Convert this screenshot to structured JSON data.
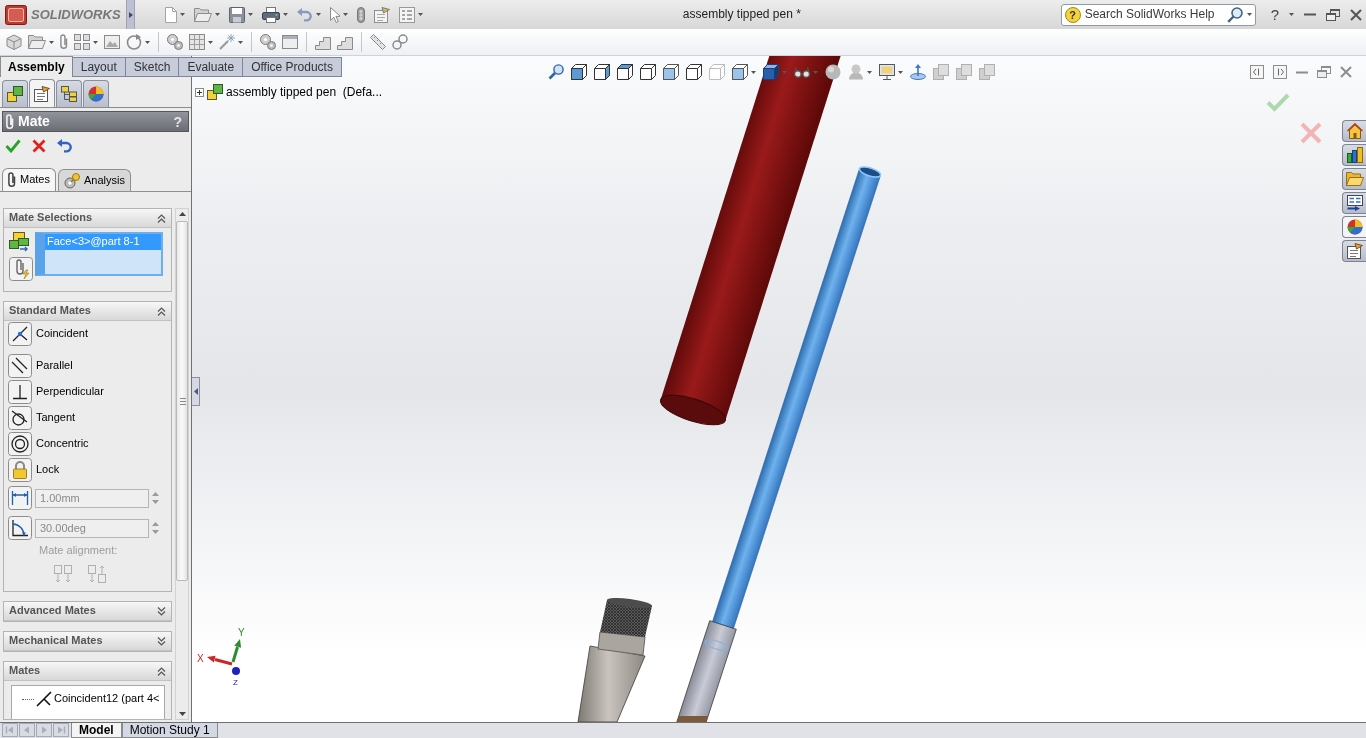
{
  "app": {
    "logo": "SOLIDWORKS",
    "title": "assembly tipped pen *",
    "search": {
      "badge": "?",
      "placeholder": "Search SolidWorks Help"
    },
    "help": "?"
  },
  "command_tabs": [
    {
      "label": "Assembly",
      "selected": true
    },
    {
      "label": "Layout",
      "selected": false
    },
    {
      "label": "Sketch",
      "selected": false
    },
    {
      "label": "Evaluate",
      "selected": false
    },
    {
      "label": "Office Products",
      "selected": false
    }
  ],
  "manager_tabs": [
    {
      "kind": "tree",
      "selected": false
    },
    {
      "kind": "property",
      "selected": true
    },
    {
      "kind": "configuration",
      "selected": false
    },
    {
      "kind": "display",
      "selected": false
    }
  ],
  "property_manager": {
    "title": "Mate",
    "help": "?",
    "tabs": [
      {
        "kind": "mates",
        "label": "Mates",
        "selected": true
      },
      {
        "kind": "analysis",
        "label": "Analysis",
        "selected": false
      }
    ],
    "groups": [
      {
        "kind": "selections",
        "title": "Mate Selections",
        "expanded": true,
        "items": [
          {
            "label": "Face<3>@part 8-1",
            "selected": true
          }
        ]
      },
      {
        "kind": "standard",
        "title": "Standard Mates",
        "expanded": true,
        "options": [
          {
            "kind": "coincident",
            "label": "Coincident"
          },
          {
            "kind": "parallel",
            "label": "Parallel"
          },
          {
            "kind": "perpendicular",
            "label": "Perpendicular"
          },
          {
            "kind": "tangent",
            "label": "Tangent"
          },
          {
            "kind": "concentric",
            "label": "Concentric"
          },
          {
            "kind": "lock",
            "label": "Lock"
          }
        ],
        "distance": {
          "value": "1.00mm",
          "disabled": true
        },
        "angle": {
          "value": "30.00deg",
          "disabled": true
        },
        "alignment": {
          "label": "Mate alignment:",
          "disabled": true
        }
      },
      {
        "kind": "plain",
        "title": "Advanced Mates",
        "expanded": false
      },
      {
        "kind": "plain",
        "title": "Mechanical Mates",
        "expanded": false
      },
      {
        "kind": "list",
        "title": "Mates",
        "expanded": true,
        "items": [
          {
            "label": "Coincident12 (part 4<"
          }
        ]
      }
    ]
  },
  "viewport": {
    "tree_root": "assembly tipped pen  (Defa...",
    "triad": {
      "x": "X",
      "y": "Y",
      "z": "Z"
    }
  },
  "task_pane": [
    {
      "kind": "home",
      "selected": false
    },
    {
      "kind": "library",
      "selected": false
    },
    {
      "kind": "files",
      "selected": false
    },
    {
      "kind": "palette",
      "selected": false
    },
    {
      "kind": "appearance",
      "selected": true
    },
    {
      "kind": "properties",
      "selected": false
    }
  ],
  "bottom_tabs": [
    {
      "label": "Model",
      "selected": true
    },
    {
      "label": "Motion Study 1",
      "selected": false
    }
  ]
}
